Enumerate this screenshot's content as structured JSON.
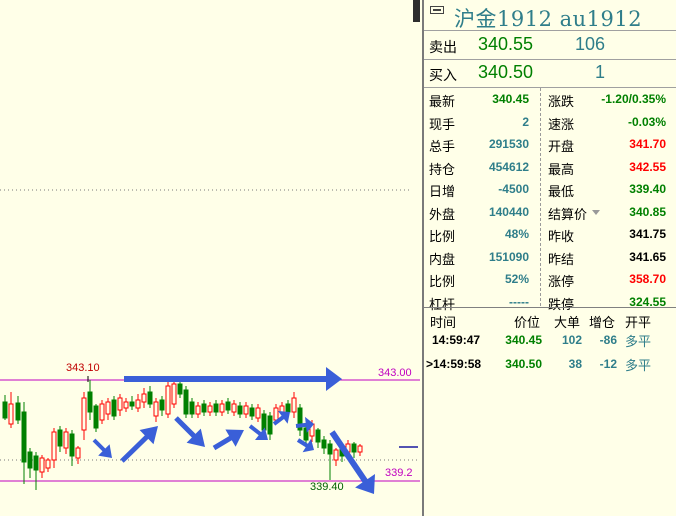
{
  "instrument": {
    "title": "沪金1912  au1912"
  },
  "orderbook": {
    "ask": {
      "label": "卖出",
      "price": "340.55",
      "volume": "106"
    },
    "bid": {
      "label": "买入",
      "price": "340.50",
      "volume": "1"
    }
  },
  "stats": {
    "left": [
      {
        "label": "最新",
        "value": "340.45"
      },
      {
        "label": "现手",
        "value": "2"
      },
      {
        "label": "总手",
        "value": "291530"
      },
      {
        "label": "持仓",
        "value": "454612"
      },
      {
        "label": "日增",
        "value": "-4500"
      },
      {
        "label": "外盘",
        "value": "140440"
      },
      {
        "label": "比例",
        "value": "48%"
      },
      {
        "label": "内盘",
        "value": "151090"
      },
      {
        "label": "比例",
        "value": "52%"
      },
      {
        "label": "杠杆",
        "value": "-----"
      }
    ],
    "right": [
      {
        "label": "涨跌",
        "value": "-1.20/0.35%"
      },
      {
        "label": "速涨",
        "value": "-0.03%"
      },
      {
        "label": "开盘",
        "value": "341.70"
      },
      {
        "label": "最高",
        "value": "342.55"
      },
      {
        "label": "最低",
        "value": "339.40"
      },
      {
        "label": "结算价",
        "value": "340.85"
      },
      {
        "label": "昨收",
        "value": "341.75"
      },
      {
        "label": "昨结",
        "value": "341.65"
      },
      {
        "label": "涨停",
        "value": "358.70"
      },
      {
        "label": "跌停",
        "value": "324.55"
      }
    ]
  },
  "trades": {
    "headers": {
      "time": "时间",
      "price": "价位",
      "size": "大单",
      "oi_change": "增仓",
      "type": "开平"
    },
    "rows": [
      {
        "time": "14:59:47",
        "price": "340.45",
        "size": "102",
        "oi_change": "-86",
        "type": "多平"
      },
      {
        "time": ">14:59:58",
        "price": "340.50",
        "size": "38",
        "oi_change": "-12",
        "type": "多平"
      }
    ]
  },
  "chart_labels": {
    "high_marker": "343.10",
    "low_marker": "339.40",
    "upper_line": "343.00",
    "lower_line": "339.2"
  },
  "colors": {
    "up": "#ff0000",
    "down": "#008000",
    "flat": "#2f7e8a",
    "level_line": "#c000c0",
    "arrow": "#3a5fd8"
  }
}
